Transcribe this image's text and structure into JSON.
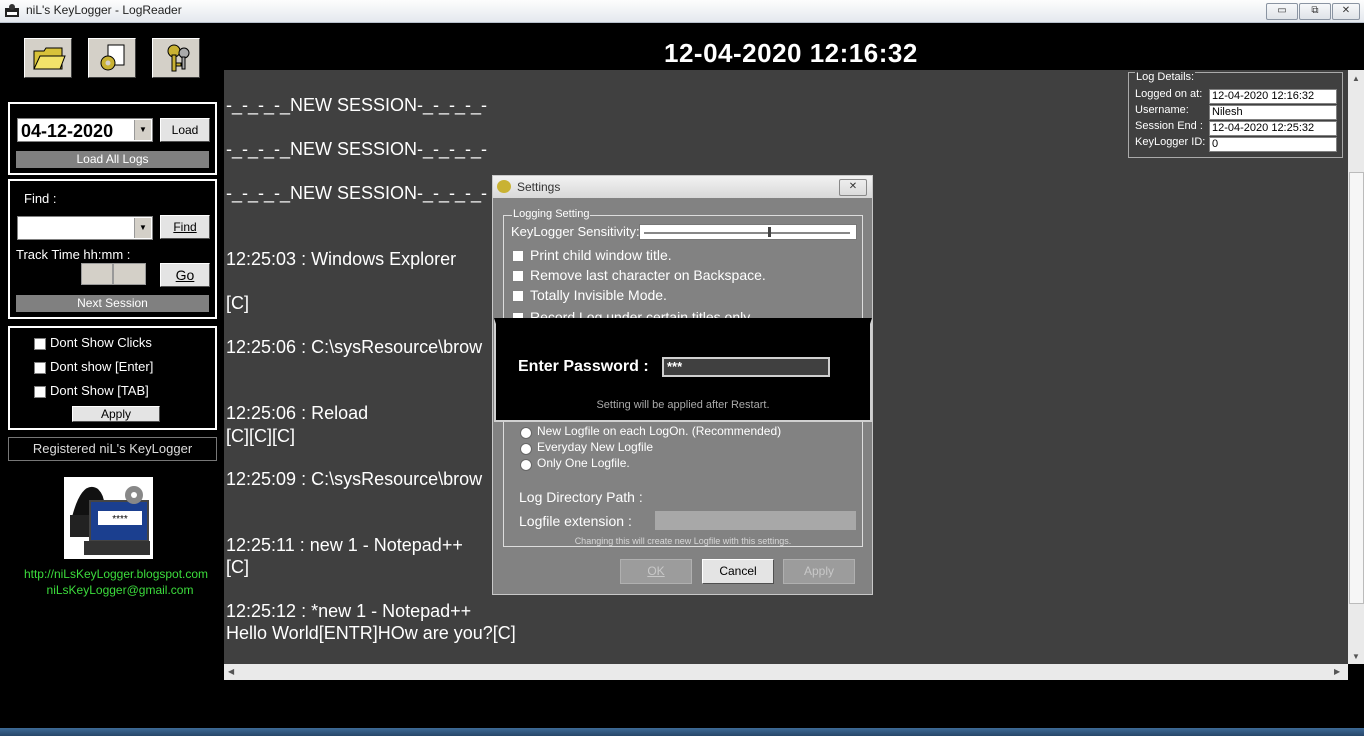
{
  "window": {
    "title": "niL's KeyLogger  -  LogReader",
    "min": "▭",
    "max": "⧉",
    "close": "✕"
  },
  "toolbar": {
    "open_icon": "folder-icon",
    "settings_icon": "settings-gear-icon",
    "keys_icon": "keys-icon"
  },
  "datetime": "12-04-2020  12:16:32",
  "load_panel": {
    "date": "04-12-2020",
    "load": "Load",
    "load_all": "Load All Logs"
  },
  "find_panel": {
    "find_label": "Find :",
    "find_button": "Find",
    "track_label": "Track Time hh:mm :",
    "go": "Go",
    "next_session": "Next Session"
  },
  "filters": {
    "items": [
      "Dont Show Clicks",
      "Dont show [Enter]",
      "Dont Show [TAB]"
    ],
    "apply": "Apply"
  },
  "registered": "Registered niL's KeyLogger",
  "links": {
    "blog": "http://niLsKeyLogger.blogspot.com",
    "email": "niLsKeyLogger@gmail.com"
  },
  "logo_text": "****",
  "log_lines": [
    "-_-_-_-_NEW SESSION-_-_-_-_-",
    "-_-_-_-_NEW SESSION-_-_-_-_-",
    "-_-_-_-_NEW SESSION-_-_-_-_-",
    "12:25:03 : Windows Explorer",
    "[C]",
    "12:25:06 : C:\\sysResource\\brow",
    "12:25:06 : Reload",
    "[C][C][C]",
    "12:25:09 : C:\\sysResource\\brow",
    "12:25:11 : new 1 - Notepad++",
    "[C]",
    "12:25:12 : *new 1 - Notepad++",
    "Hello World[ENTR]HOw are you?[C]"
  ],
  "details": {
    "legend": "Log Details:",
    "rows": [
      {
        "label": "Logged on at:",
        "value": "12-04-2020  12:16:32"
      },
      {
        "label": "Username:",
        "value": "Nilesh"
      },
      {
        "label": "Session End :",
        "value": "12-04-2020 12:25:32"
      },
      {
        "label": "KeyLogger ID:",
        "value": "0"
      }
    ]
  },
  "settings": {
    "title": "Settings",
    "group": "Logging Setting",
    "sensitivity": "KeyLogger Sensitivity:",
    "sensitivity_level": 0.6,
    "options": [
      "Print child window title.",
      "Remove last character on Backspace.",
      "Totally Invisible Mode.",
      "Record Log under certain titles only"
    ],
    "logfile_options": [
      "New Logfile on each LogOn. (Recommended)",
      "Everyday New Logfile",
      "Only One Logfile."
    ],
    "dir_path": "Log Directory Path :",
    "extension": "Logfile extension :",
    "note": "Changing this will create new Logfile with this settings.",
    "ok": "OK",
    "cancel": "Cancel",
    "apply": "Apply"
  },
  "password": {
    "label": "Enter Password :",
    "value": "***",
    "note": "Setting will be applied after Restart."
  }
}
